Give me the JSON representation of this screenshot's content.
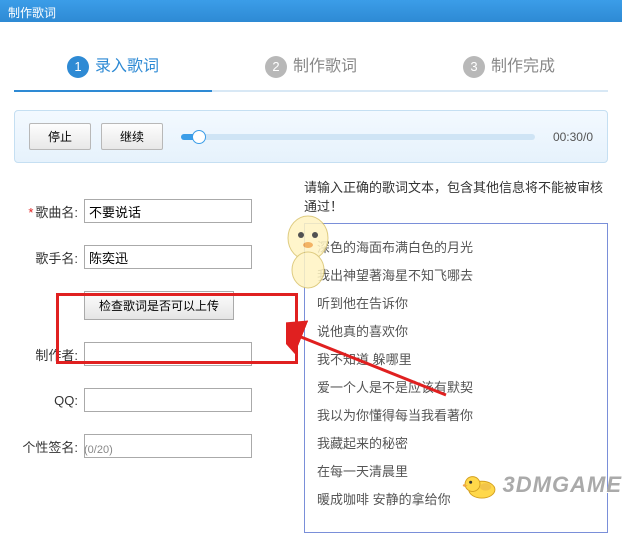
{
  "window": {
    "title": "制作歌词"
  },
  "steps": [
    {
      "num": "1",
      "label": "录入歌词",
      "active": true
    },
    {
      "num": "2",
      "label": "制作歌词",
      "active": false
    },
    {
      "num": "3",
      "label": "制作完成",
      "active": false
    }
  ],
  "player": {
    "stop": "停止",
    "resume": "继续",
    "time": "00:30/0"
  },
  "form": {
    "song_label": "歌曲名:",
    "song_value": "不要说话",
    "singer_label": "歌手名:",
    "singer_value": "陈奕迅",
    "check_btn": "检查歌词是否可以上传",
    "author_label": "制作者:",
    "author_value": "",
    "qq_label": "QQ:",
    "qq_value": "",
    "sign_label": "个性签名:",
    "sign_counter": "(0/20)",
    "sign_value": ""
  },
  "lyrics": {
    "hint": "请输入正确的歌词文本，包含其他信息将不能被审核通过！",
    "lines": [
      "深色的海面布满白色的月光",
      "我出神望著海星不知飞哪去",
      "听到他在告诉你",
      "说他真的喜欢你",
      "我不知道 躲哪里",
      "爱一个人是不是应该有默契",
      "我以为你懂得每当我看著你",
      "我藏起来的秘密",
      "在每一天清晨里",
      "暖成咖啡 安静的拿给你"
    ]
  },
  "watermark": {
    "text": "3DMGAME"
  }
}
